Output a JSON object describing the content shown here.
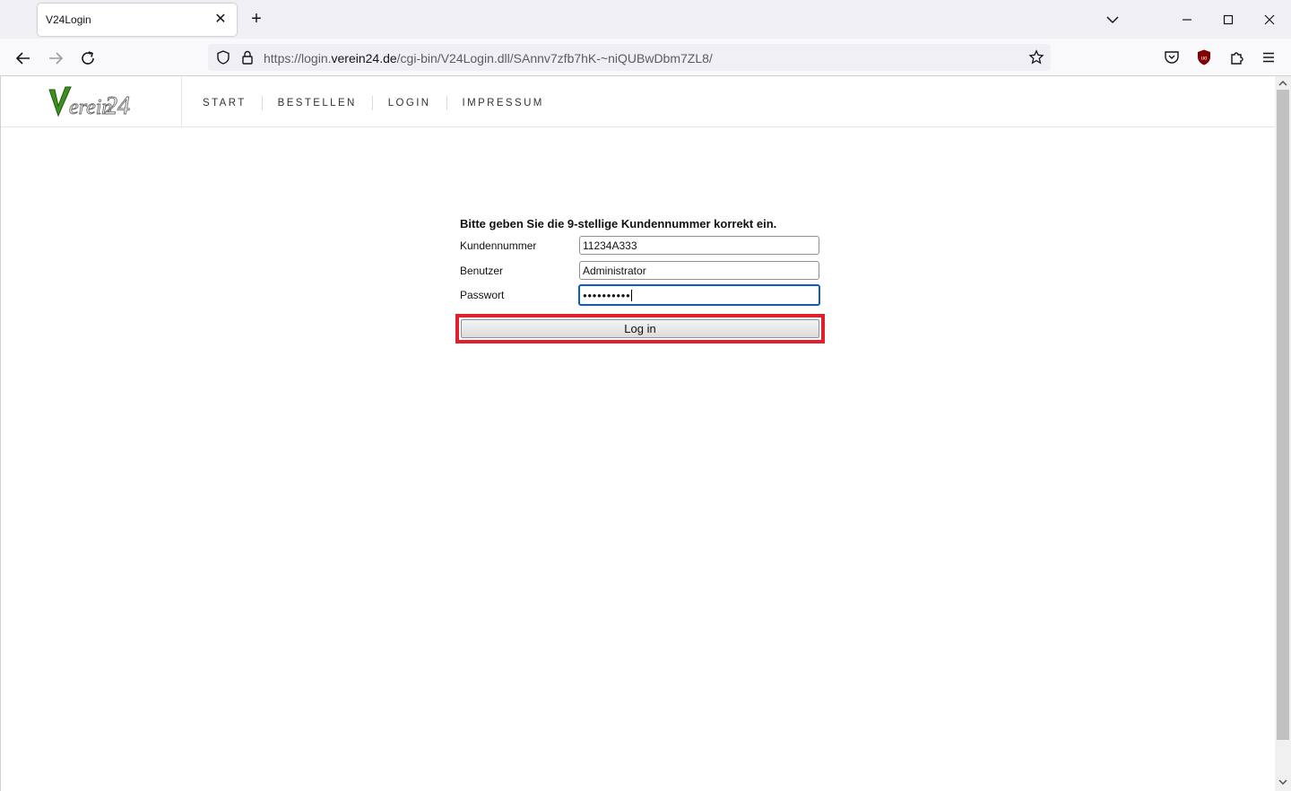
{
  "browser": {
    "tab": {
      "title": "V24Login",
      "close_glyph": "✕"
    },
    "new_tab_glyph": "+",
    "url": {
      "prefix": "https://login.",
      "domain": "verein24.de",
      "suffix": "/cgi-bin/V24Login.dll/SAnnv7zfb7hK-~niQUBwDbm7ZL8/"
    }
  },
  "site": {
    "logo_text": "Verein24",
    "nav": [
      "START",
      "BESTELLEN",
      "LOGIN",
      "IMPRESSUM"
    ]
  },
  "form": {
    "heading": "Bitte geben Sie die 9-stellige Kundennummer korrekt ein.",
    "customer_label": "Kundennummer",
    "customer_value": "11234A333",
    "user_label": "Benutzer",
    "user_value": "Administrator",
    "password_label": "Passwort",
    "password_mask": "●●●●●●●●●●",
    "login_label": "Log in"
  },
  "colors": {
    "highlight": "#e0202a",
    "focus": "#0a5bcb",
    "logo_green": "#3f8f1e"
  }
}
